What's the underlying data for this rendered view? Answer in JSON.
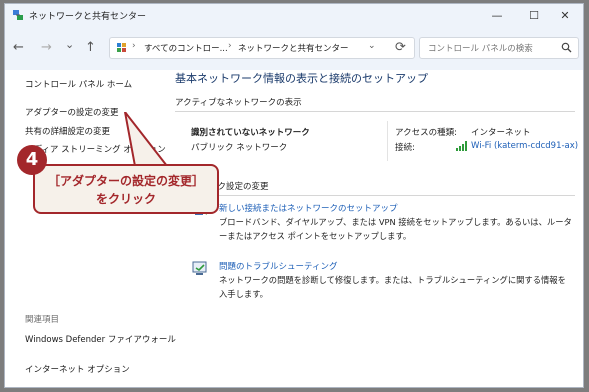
{
  "window": {
    "title": "ネットワークと共有センター",
    "controls": {
      "minimize": "—",
      "maximize": "☐",
      "close": "✕"
    }
  },
  "nav": {
    "back": "←",
    "forward": "→",
    "dropdown": "⌄",
    "up": "↑",
    "refresh": "⟳",
    "breadcrumb": [
      "すべてのコントロー...",
      "ネットワークと共有センター"
    ],
    "separator": "›",
    "search_placeholder": "コントロール パネルの検索"
  },
  "sidebar": {
    "links": [
      "コントロール パネル ホーム",
      "アダプターの設定の変更",
      "共有の詳細設定の変更",
      "メディア ストリーミング オプション"
    ],
    "related_heading": "関連項目",
    "related_links": [
      "Windows Defender ファイアウォール",
      "インターネット オプション"
    ]
  },
  "main": {
    "title": "基本ネットワーク情報の表示と接続のセットアップ",
    "active_networks_heading": "アクティブなネットワークの表示",
    "network": {
      "name": "識別されていないネットワーク",
      "type": "パブリック ネットワーク",
      "access_type_label": "アクセスの種類:",
      "access_type_value": "インターネット",
      "connection_label": "接続:",
      "connection_value": "Wi-Fi (katerm-cdcd91-ax)"
    },
    "change_settings_heading": "ネットワーク設定の変更",
    "tasks": [
      {
        "link": "新しい接続またはネットワークのセットアップ",
        "description": "ブロードバンド、ダイヤルアップ、または VPN 接続をセットアップします。あるいは、ルーターまたはアクセス ポイントをセットアップします。",
        "icon": "network-setup-icon"
      },
      {
        "link": "問題のトラブルシューティング",
        "description": "ネットワークの問題を診断して修復します。または、トラブルシューティングに関する情報を入手します。",
        "icon": "troubleshoot-icon"
      }
    ]
  },
  "callout": {
    "step": "4",
    "line1": "［アダプターの設定の変更］",
    "line2": "をクリック",
    "color": "#a3272b"
  }
}
